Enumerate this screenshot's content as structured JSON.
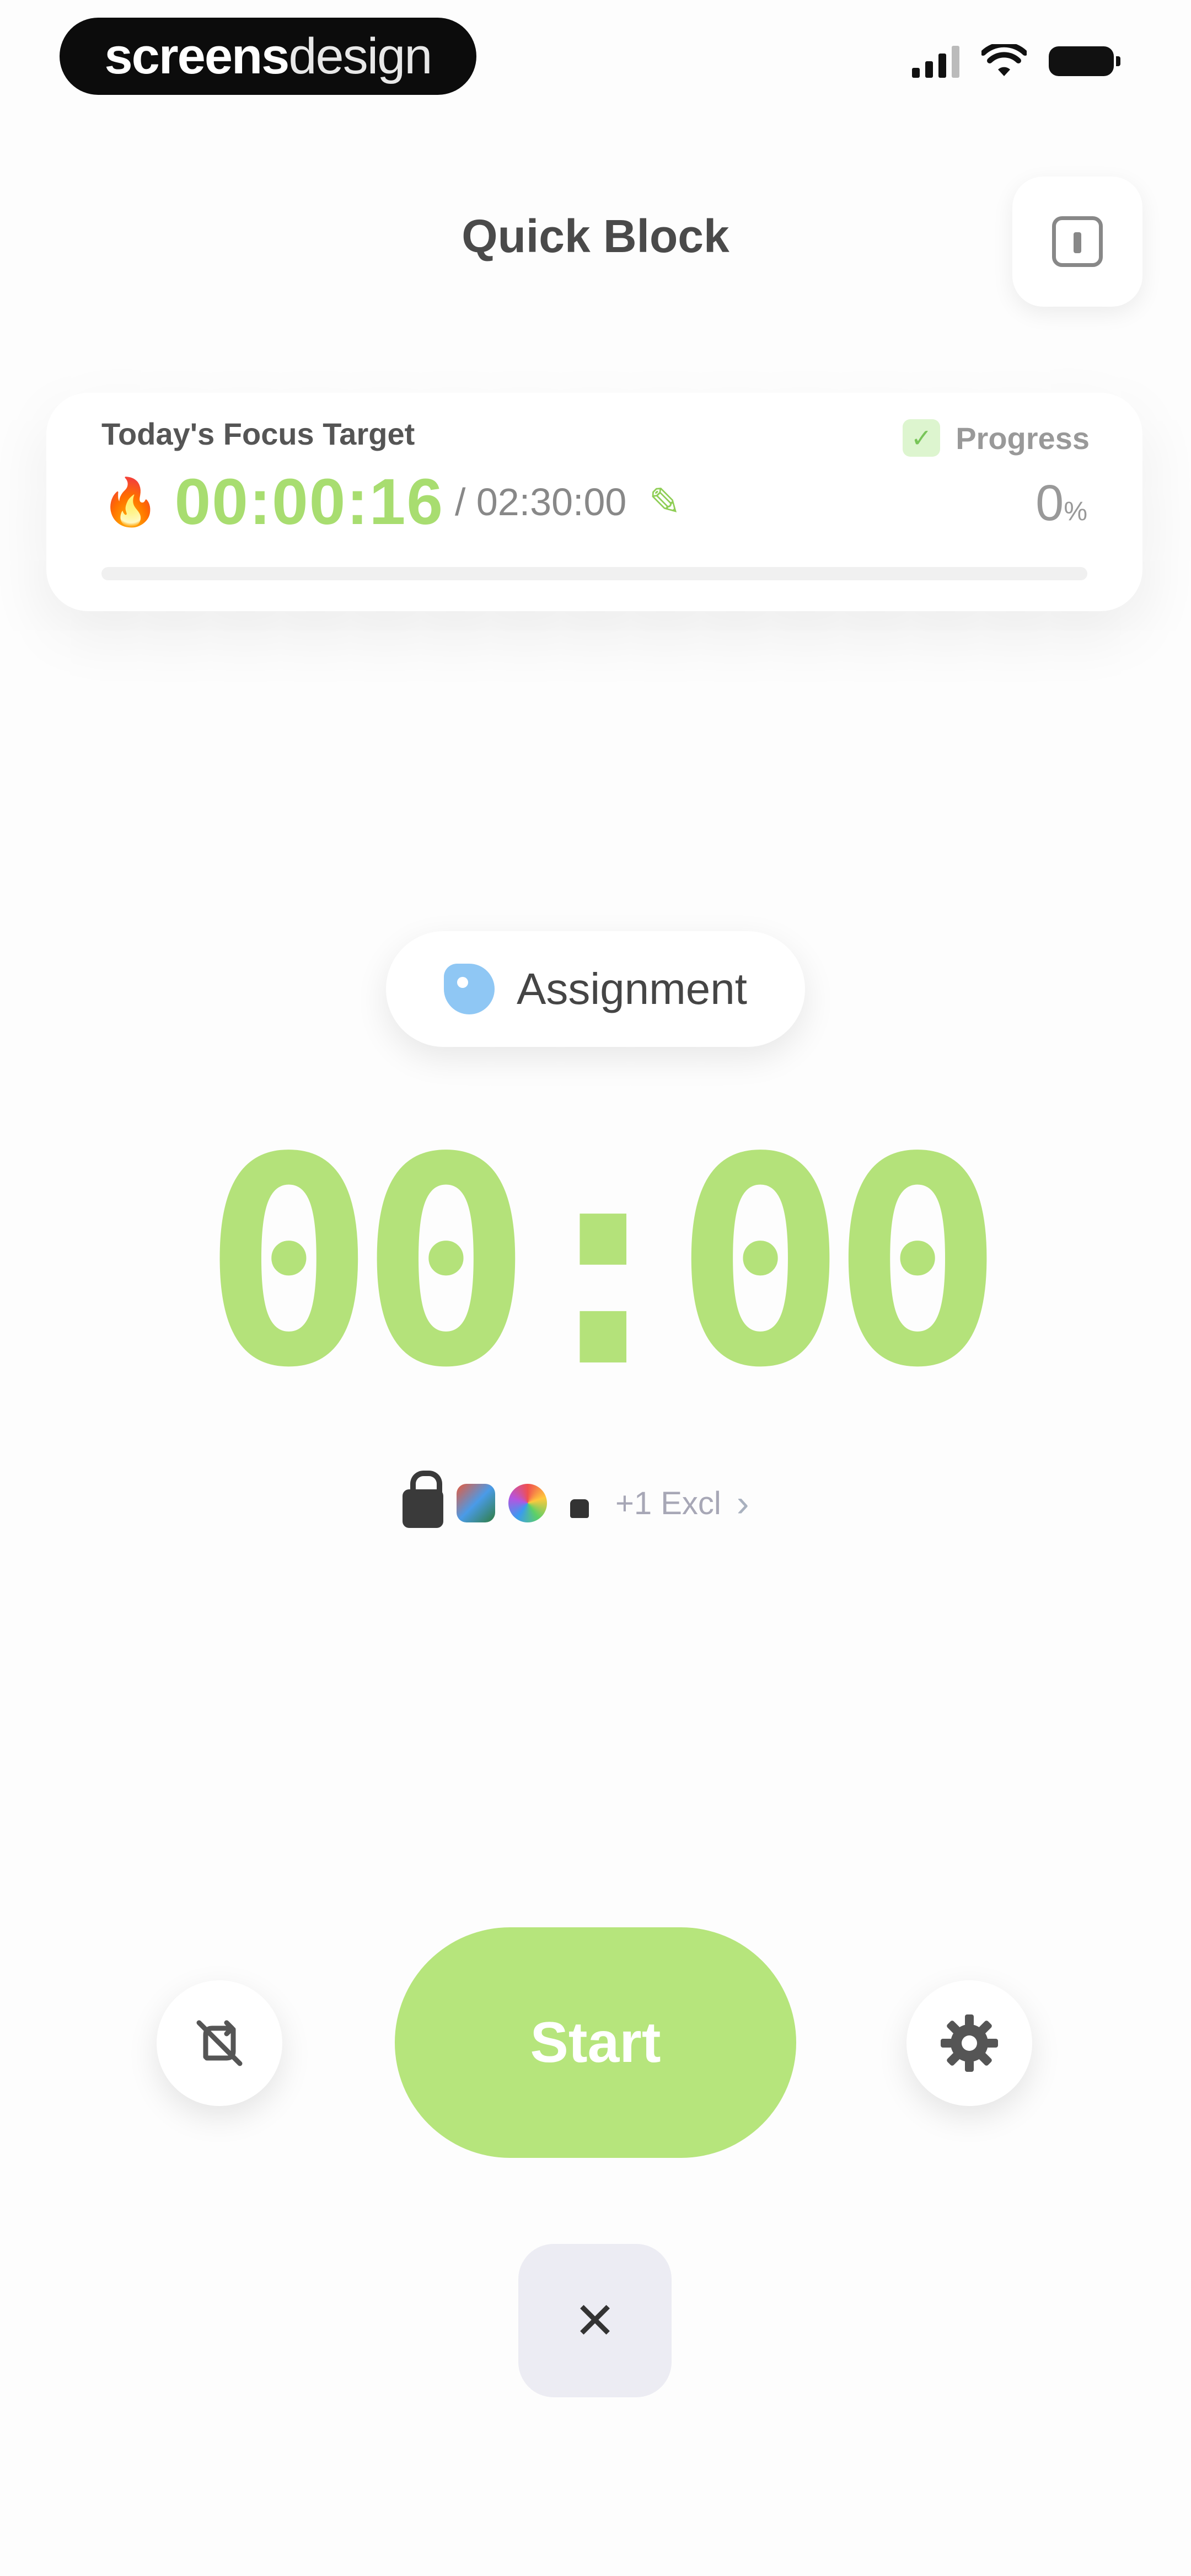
{
  "status_bar": {
    "brand_part1": "screens",
    "brand_part2": "design"
  },
  "header": {
    "title": "Quick Block",
    "action_icon": "info-icon"
  },
  "focus_card": {
    "label": "Today's Focus Target",
    "elapsed": "00:00:16",
    "target": "/ 02:30:00",
    "progress_label": "Progress",
    "progress_percent": "0",
    "progress_unit": "%",
    "progress_value": 0,
    "accent_color": "#a8dd70"
  },
  "session": {
    "tag_label": "Assignment",
    "timer": "00:00"
  },
  "blocked_apps": {
    "extra_label": "+1 Excl",
    "icons": [
      "lock-icon",
      "app-icon-1",
      "app-icon-2",
      "app-icon-3"
    ]
  },
  "controls": {
    "start_label": "Start",
    "start_color": "#b6e57c",
    "left_icon": "no-repeat-icon",
    "right_icon": "settings-icon",
    "close_icon": "close-icon"
  }
}
